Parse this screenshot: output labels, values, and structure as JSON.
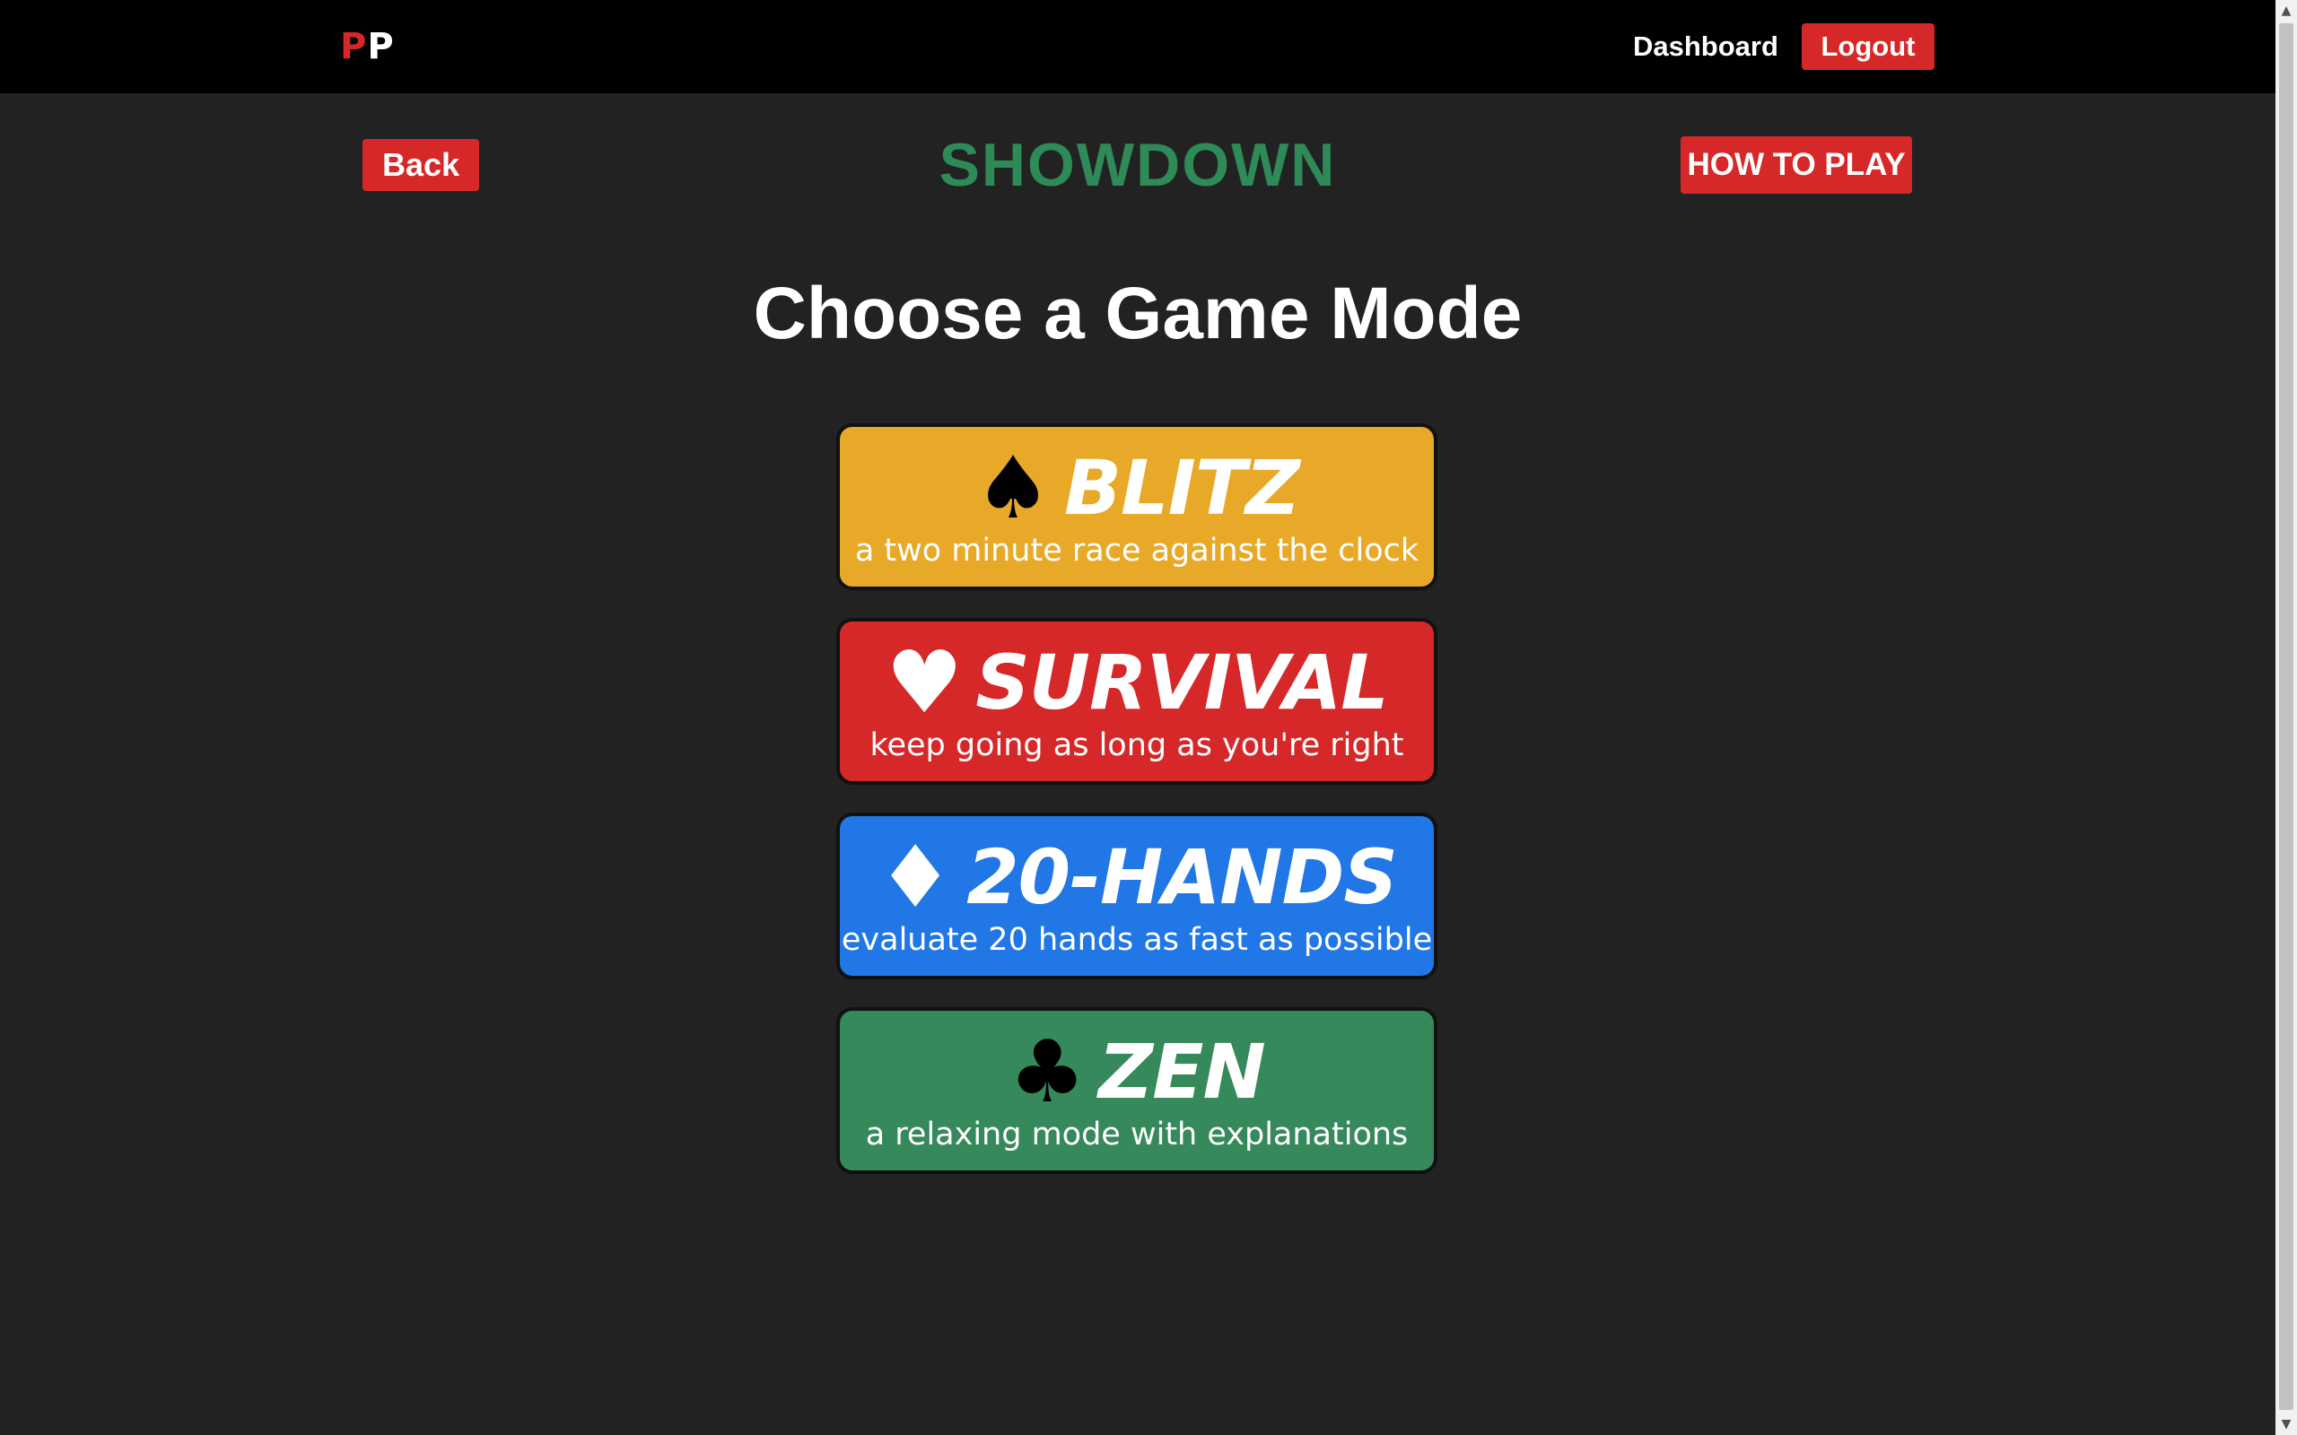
{
  "navbar": {
    "logo_first": "P",
    "logo_second": "P",
    "dashboard_label": "Dashboard",
    "logout_label": "Logout"
  },
  "header": {
    "back_label": "Back",
    "title": "SHOWDOWN",
    "how_to_play_label": "HOW TO PLAY"
  },
  "main": {
    "heading": "Choose a Game Mode",
    "modes": [
      {
        "suit": "♠",
        "suit_icon": "spade-icon",
        "name": "BLITZ",
        "description": "a two minute race against the clock",
        "color": "#e8a928"
      },
      {
        "suit": "♥",
        "suit_icon": "heart-icon",
        "name": "SURVIVAL",
        "description": "keep going as long as you're right",
        "color": "#d62828"
      },
      {
        "suit": "♦",
        "suit_icon": "diamond-icon",
        "name": "20-HANDS",
        "description": "evaluate 20 hands as fast as possible",
        "color": "#2077e5"
      },
      {
        "suit": "♣",
        "suit_icon": "club-icon",
        "name": "ZEN",
        "description": "a relaxing mode with explanations",
        "color": "#36895a"
      }
    ]
  },
  "colors": {
    "background": "#222222",
    "navbar": "#000000",
    "accent_red": "#d62828",
    "title_green": "#2e8b57"
  },
  "scrollbar": {
    "up_arrow": "▲",
    "down_arrow": "▼"
  }
}
